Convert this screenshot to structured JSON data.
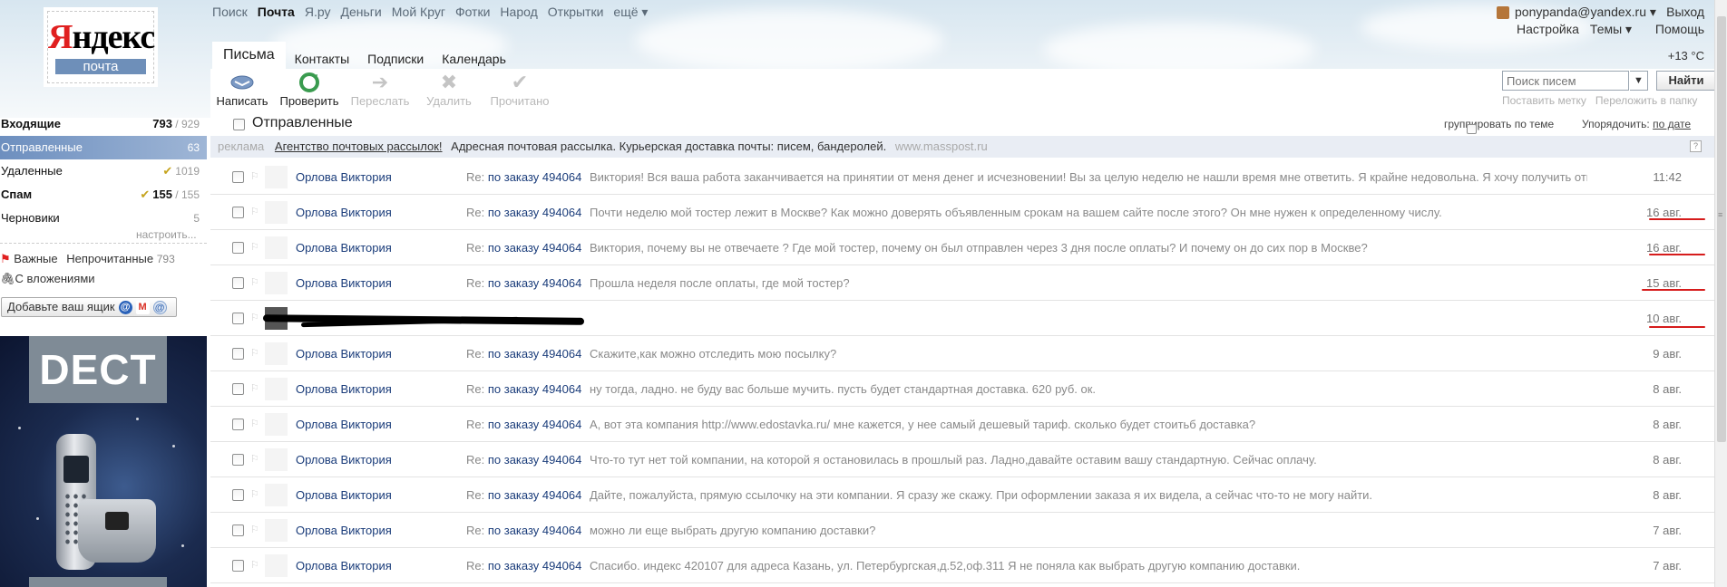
{
  "logo": {
    "wordmark_red": "Я",
    "wordmark_rest": "ндекс",
    "sub": "почта"
  },
  "topnav": [
    "Поиск",
    "Почта",
    "Я.ру",
    "Деньги",
    "Мой Круг",
    "Фотки",
    "Народ",
    "Открытки",
    "ещё ▾"
  ],
  "topnav_active_index": 1,
  "user": {
    "email": "ponypanda@yandex.ru ▾",
    "exit": "Выход",
    "settings": "Настройка",
    "themes": "Темы ▾",
    "help": "Помощь",
    "weather": "+13 °С"
  },
  "tabs": [
    "Письма",
    "Контакты",
    "Подписки",
    "Календарь"
  ],
  "toolbar": {
    "compose": "Написать",
    "check": "Проверить",
    "forward": "Переслать",
    "delete": "Удалить",
    "read": "Прочитано"
  },
  "search": {
    "placeholder": "Поиск писем",
    "dropdown": "▼",
    "button": "Найти",
    "set_label": "Поставить метку",
    "move_folder": "Переложить в папку"
  },
  "folder_header": {
    "title": "Отправленные",
    "group_by_topic": "группировать по теме",
    "order_label": "Упорядочить:",
    "order_value": "по дате"
  },
  "ad": {
    "tag": "реклама",
    "link": "Агентство почтовых рассылок!",
    "text": "Адресная почтовая рассылка. Курьерская доставка почты: писем, бандеролей.",
    "url": "www.masspost.ru",
    "help": "?"
  },
  "messages": [
    {
      "sender": "Орлова Виктория",
      "re": "Re:",
      "subject": "по заказу 494064",
      "snippet": "Виктория! Вся ваша работа заканчивается на принятии от меня денег и исчезновении! Вы за целую неделю не нашли время мне ответить. Я крайне недовольна. Я хочу получить ответы на",
      "date": "11:42",
      "underlined": false,
      "redacted": false
    },
    {
      "sender": "Орлова Виктория",
      "re": "Re:",
      "subject": "по заказу 494064",
      "snippet": "Почти неделю мой тостер лежит в Москве? Как можно доверять объявленным срокам на вашем сайте после этого? Он мне нужен к определенному числу.",
      "date": "16 авг.",
      "underlined": true,
      "redacted": false
    },
    {
      "sender": "Орлова Виктория",
      "re": "Re:",
      "subject": "по заказу 494064",
      "snippet": "Виктория, почему вы не отвечаете ? Где мой тостер, почему он был отправлен через 3 дня после оплаты? И почему он до сих пор в Москве?",
      "date": "16 авг.",
      "underlined": true,
      "redacted": false
    },
    {
      "sender": "Орлова Виктория",
      "re": "Re:",
      "subject": "по заказу 494064",
      "snippet": "Прошла неделя после оплаты, где мой тостер?",
      "date": "15 авг.",
      "underlined": true,
      "redacted": false
    },
    {
      "sender": "",
      "re": "",
      "subject": "",
      "snippet": "",
      "date": "10 авг.",
      "underlined": true,
      "redacted": true
    },
    {
      "sender": "Орлова Виктория",
      "re": "Re:",
      "subject": "по заказу 494064",
      "snippet": "Скажите,как можно отследить мою посылку?",
      "date": "9 авг.",
      "underlined": false,
      "redacted": false
    },
    {
      "sender": "Орлова Виктория",
      "re": "Re:",
      "subject": "по заказу 494064",
      "snippet": "ну тогда, ладно. не буду вас больше мучить. пусть будет стандартная доставка. 620 руб. ок.",
      "date": "8 авг.",
      "underlined": false,
      "redacted": false
    },
    {
      "sender": "Орлова Виктория",
      "re": "Re:",
      "subject": "по заказу 494064",
      "snippet": "А, вот эта компания http://www.edostavka.ru/ мне кажется, у нее самый дешевый тариф. сколько будет стоитьб доставка?",
      "date": "8 авг.",
      "underlined": false,
      "redacted": false
    },
    {
      "sender": "Орлова Виктория",
      "re": "Re:",
      "subject": "по заказу 494064",
      "snippet": "Что-то тут нет той компании, на которой я остановилась в прошлый раз. Ладно,давайте оставим вашу стандартную. Сейчас оплачу.",
      "date": "8 авг.",
      "underlined": false,
      "redacted": false
    },
    {
      "sender": "Орлова Виктория",
      "re": "Re:",
      "subject": "по заказу 494064",
      "snippet": "Дайте, пожалуйста, прямую ссылочку на эти компании. Я сразу же скажу. При оформлении заказа я их видела, а сейчас что-то не могу найти.",
      "date": "8 авг.",
      "underlined": false,
      "redacted": false
    },
    {
      "sender": "Орлова Виктория",
      "re": "Re:",
      "subject": "по заказу 494064",
      "snippet": "можно ли еще выбрать другую компанию доставки?",
      "date": "7 авг.",
      "underlined": false,
      "redacted": false
    },
    {
      "sender": "Орлова Виктория",
      "re": "Re:",
      "subject": "по заказу 494064",
      "snippet": "Спасибо. индекс 420107 для адреса Казань, ул. Петербургская,д.52,оф.311 Я не поняла как выбрать другую компанию доставки.",
      "date": "7 авг.",
      "underlined": false,
      "redacted": false
    }
  ],
  "sidebar": {
    "folders": [
      {
        "name": "Входящие",
        "count_new": "793",
        "count_total": "/ 929",
        "bold": true,
        "active": false,
        "mark": ""
      },
      {
        "name": "Отправленные",
        "count_new": "",
        "count_total": "63",
        "bold": false,
        "active": true,
        "mark": ""
      },
      {
        "name": "Удаленные",
        "count_new": "",
        "count_total": "1019",
        "bold": false,
        "active": false,
        "mark": "✔"
      },
      {
        "name": "Спам",
        "count_new": "155",
        "count_total": "/ 155",
        "bold": true,
        "active": false,
        "mark": "✔"
      },
      {
        "name": "Черновики",
        "count_new": "",
        "count_total": "5",
        "bold": false,
        "active": false,
        "mark": ""
      }
    ],
    "configure": "настроить...",
    "important": "Важные",
    "unread": "Непрочитанные",
    "unread_count": "793",
    "attachments": "С вложениями",
    "add_box": "Добавьте ваш ящик"
  },
  "banner": {
    "brand": "DECT"
  },
  "colors": {
    "accent": "#6d8fbf",
    "link": "#1a3c7a",
    "underline_mark": "#d61c1c"
  }
}
